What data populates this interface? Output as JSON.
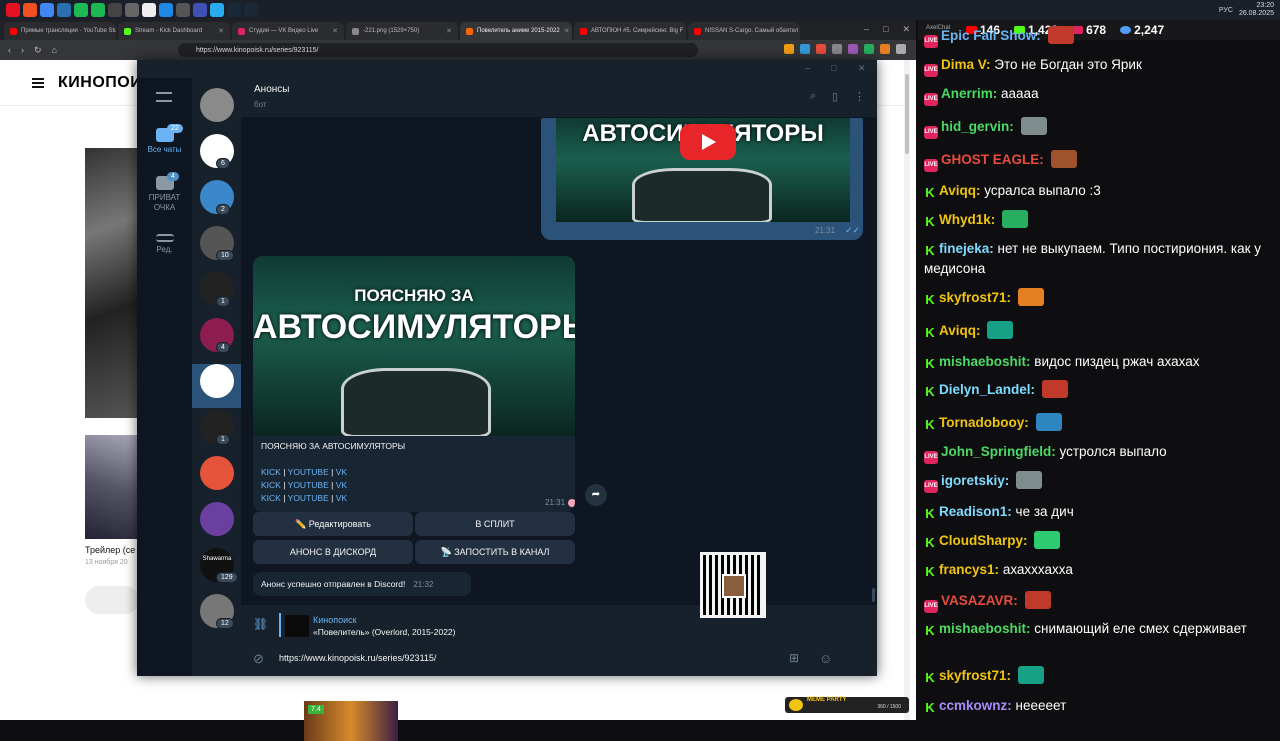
{
  "browser": {
    "tabs": [
      {
        "label": "Прямые трансляции - YouTube Studio",
        "color": "#ff0000"
      },
      {
        "label": "Stream - Kick Dashboard",
        "color": "#53fc18"
      },
      {
        "label": "Студия — VK Видео Live",
        "color": "#e0245e"
      },
      {
        "label": "-221.png (1529×750)",
        "color": "#888888"
      },
      {
        "label": "Повелитель аниме 2015-2022",
        "color": "#ff6600",
        "active": true
      },
      {
        "label": "АВТОПЮН #5. Симрейсинг. Big F",
        "color": "#ff0000"
      },
      {
        "label": "NISSAN S-Cargo. Самый обаятел",
        "color": "#ff0000"
      }
    ],
    "url": "https://www.kinopoisk.ru/series/923115/"
  },
  "kinopoisk": {
    "logo": "КИНОПОИСК",
    "trailer_title": "Трейлер (се",
    "trailer_date": "13 ноября 20",
    "rating_badge": "7.4"
  },
  "telegram": {
    "folders": [
      {
        "label": "Все чаты",
        "badge": "22"
      },
      {
        "label": "ПРИВАТ ОЧКА",
        "badge": "4"
      },
      {
        "label": "Ред.",
        "badge": ""
      }
    ],
    "chat_badges": [
      "",
      "6",
      "2",
      "10",
      "1",
      "4",
      "",
      "1",
      "",
      "",
      "129",
      "12"
    ],
    "avatar_label": "Shawarma",
    "header": {
      "title": "Анонсы",
      "subtitle": "бот"
    },
    "top_message": {
      "title": "АВТОСИМУЛЯТОРЫ",
      "time": "21:31"
    },
    "main_message": {
      "image_title_1": "ПОЯСНЯЮ ЗА",
      "image_title_2": "АВТОСИМУЛЯТОРЫ",
      "text": "ПОЯСНЯЮ ЗА АВТОСИМУЛЯТОРЫ",
      "link_kick": "KICK",
      "link_youtube": "YOUTUBE",
      "link_vk": "VK",
      "separator": "|",
      "time": "21:31"
    },
    "buttons": {
      "edit": "✏️ Редактировать",
      "split": "В СПЛИТ",
      "discord": "АНОНС В ДИСКОРД",
      "channel": "📡 ЗАПОСТИТЬ В КАНАЛ"
    },
    "status_message": {
      "text": "Анонс успешно отправлен в Discord!",
      "time": "21:32"
    },
    "reply": {
      "title": "Кинопоиск",
      "text": "«Повелитель» (Overlord, 2015-2022)"
    },
    "compose_text": "https://www.kinopoisk.ru/series/923115/"
  },
  "chat": {
    "app_label": "AxelChat",
    "stats": {
      "youtube": "146",
      "kick": "1,423",
      "vk": "678",
      "viewers": "2,247"
    },
    "messages": [
      {
        "platform": "vk",
        "user": "Epic Fail Show:",
        "color": "#6ab3f3",
        "text": ""
      },
      {
        "platform": "vk",
        "user": "Dima V:",
        "color": "#f1c40f",
        "text": "Это не Богдан это Ярик"
      },
      {
        "platform": "vk",
        "user": "Anerrim:",
        "color": "#4cd964",
        "text": "ааааа"
      },
      {
        "platform": "vk",
        "user": "hid_gervin:",
        "color": "#4cd964",
        "text": ""
      },
      {
        "platform": "vk",
        "user": "GHOST EAGLE:",
        "color": "#e74c3c",
        "text": ""
      },
      {
        "platform": "kick",
        "user": "Aviqq:",
        "color": "#f1c40f",
        "text": "усралса выпало :3"
      },
      {
        "platform": "kick",
        "user": "Whyd1k:",
        "color": "#f1c40f",
        "text": ""
      },
      {
        "platform": "kick",
        "user": "finejeka:",
        "color": "#7fdbff",
        "text": "нет не выкупаем. Типо постириония. как у медисона"
      },
      {
        "platform": "kick",
        "user": "skyfrost71:",
        "color": "#f1c40f",
        "text": ""
      },
      {
        "platform": "kick",
        "user": "Aviqq:",
        "color": "#f1c40f",
        "text": ""
      },
      {
        "platform": "kick",
        "user": "mishaeboshit:",
        "color": "#4cd964",
        "text": "видос пиздец ржач ахахах"
      },
      {
        "platform": "kick",
        "user": "Dielyn_Landel:",
        "color": "#7fdbff",
        "text": ""
      },
      {
        "platform": "kick",
        "user": "Tornadobooy:",
        "color": "#f1c40f",
        "text": ""
      },
      {
        "platform": "vk",
        "user": "John_Springfield:",
        "color": "#4cd964",
        "text": "устролся выпало"
      },
      {
        "platform": "vk",
        "user": "igoretskiy:",
        "color": "#7fdbff",
        "text": ""
      },
      {
        "platform": "kick",
        "user": "Readison1:",
        "color": "#7fdbff",
        "text": "че за дич"
      },
      {
        "platform": "kick",
        "user": "CloudSharpy:",
        "color": "#f1c40f",
        "text": ""
      },
      {
        "platform": "kick",
        "user": "francys1:",
        "color": "#f1c40f",
        "text": "ахахххахха"
      },
      {
        "platform": "vk",
        "user": "VASAZAVR:",
        "color": "#e74c3c",
        "text": ""
      },
      {
        "platform": "kick",
        "user": "mishaeboshit:",
        "color": "#4cd964",
        "text": "снимающий еле смех сдерживает"
      },
      {
        "platform": "kick",
        "user": "skyfrost71:",
        "color": "#f1c40f",
        "text": ""
      },
      {
        "platform": "kick",
        "user": "ccmkownz:",
        "color": "#a78bfa",
        "text": "неееeет"
      }
    ]
  },
  "system": {
    "clock_time": "23:20",
    "clock_date": "26.08.2025",
    "lang": "РУС"
  },
  "overlay": {
    "meme_party": "MEME PARTY",
    "meme_count": "360 / 1500"
  }
}
